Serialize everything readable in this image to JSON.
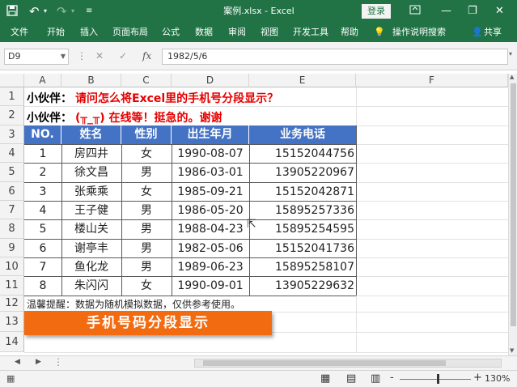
{
  "title_bar": {
    "title": "案例.xlsx  -  Excel",
    "login_label": "登录",
    "accent_color": "#217346"
  },
  "ribbon": {
    "tabs": [
      "文件",
      "开始",
      "插入",
      "页面布局",
      "公式",
      "数据",
      "审阅",
      "视图",
      "开发工具",
      "帮助"
    ],
    "tell_me": "操作说明搜索",
    "share": "共享"
  },
  "formula_bar": {
    "name_box": "D9",
    "formula": "1982/5/6",
    "fx_label": "fx"
  },
  "sheet": {
    "columns": [
      "A",
      "B",
      "C",
      "D",
      "E",
      "F"
    ],
    "rows": [
      "1",
      "2",
      "3",
      "4",
      "5",
      "6",
      "7",
      "8",
      "9",
      "10",
      "11",
      "12",
      "13",
      "14"
    ],
    "line1_label": "小伙伴：",
    "line1_text": "请问怎么将Excel里的手机号分段显示？",
    "line2_label": "小伙伴：",
    "line2_text": "(╥_╥) 在线等！挺急的。谢谢",
    "table_header": [
      "NO.",
      "姓名",
      "性别",
      "出生年月",
      "业务电话"
    ],
    "table_rows": [
      [
        "1",
        "房四井",
        "女",
        "1990-08-07",
        "15152044756"
      ],
      [
        "2",
        "徐文昌",
        "男",
        "1986-03-01",
        "13905220967"
      ],
      [
        "3",
        "张乘乘",
        "女",
        "1985-09-21",
        "15152042871"
      ],
      [
        "4",
        "王子健",
        "男",
        "1986-05-20",
        "15895257336"
      ],
      [
        "5",
        "楼山关",
        "男",
        "1988-04-23",
        "15895254595"
      ],
      [
        "6",
        "谢亭丰",
        "男",
        "1982-05-06",
        "15152041736"
      ],
      [
        "7",
        "鱼化龙",
        "男",
        "1989-06-23",
        "15895258107"
      ],
      [
        "8",
        "朱闪闪",
        "女",
        "1990-09-01",
        "13905229632"
      ]
    ],
    "note": "温馨提醒：数据为随机模拟数据，仅供参考使用。",
    "banner": "手机号码分段显示",
    "header_color": "#4472c4",
    "banner_color": "#f26b10"
  },
  "status_bar": {
    "zoom": "130%",
    "minus": "-",
    "plus": "+"
  }
}
